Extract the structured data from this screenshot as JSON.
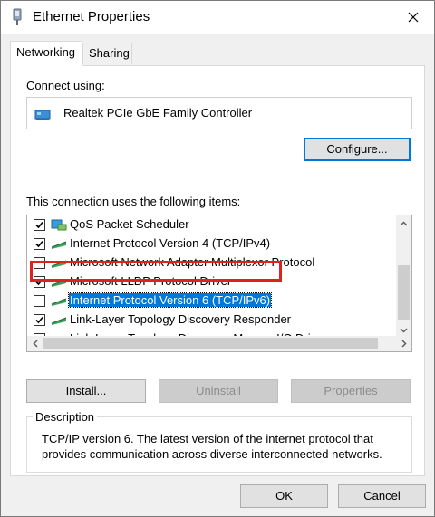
{
  "window": {
    "title": "Ethernet Properties"
  },
  "tabs": [
    {
      "label": "Networking",
      "active": true
    },
    {
      "label": "Sharing",
      "active": false
    }
  ],
  "connect": {
    "label": "Connect using:",
    "adapter": "Realtek PCIe GbE Family Controller",
    "configure_label": "Configure..."
  },
  "items_label": "This connection uses the following items:",
  "items": [
    {
      "label": "QoS Packet Scheduler",
      "checked": true,
      "icon": "qos-icon"
    },
    {
      "label": "Internet Protocol Version 4 (TCP/IPv4)",
      "checked": true,
      "icon": "protocol-icon"
    },
    {
      "label": "Microsoft Network Adapter Multiplexor Protocol",
      "checked": false,
      "icon": "protocol-icon"
    },
    {
      "label": "Microsoft LLDP Protocol Driver",
      "checked": true,
      "icon": "protocol-icon"
    },
    {
      "label": "Internet Protocol Version 6 (TCP/IPv6)",
      "checked": false,
      "icon": "protocol-icon",
      "selected": true
    },
    {
      "label": "Link-Layer Topology Discovery Responder",
      "checked": true,
      "icon": "protocol-icon"
    },
    {
      "label": "Link-Layer Topology Discovery Mapper I/O Driver",
      "checked": true,
      "icon": "protocol-icon"
    }
  ],
  "buttons": {
    "install": "Install...",
    "uninstall": "Uninstall",
    "properties": "Properties",
    "ok": "OK",
    "cancel": "Cancel"
  },
  "description": {
    "legend": "Description",
    "text": "TCP/IP version 6. The latest version of the internet protocol that provides communication across diverse interconnected networks."
  },
  "colors": {
    "accent": "#0078d7",
    "highlight_border": "#e1201f",
    "dialog_bg": "#f0f0f0"
  }
}
